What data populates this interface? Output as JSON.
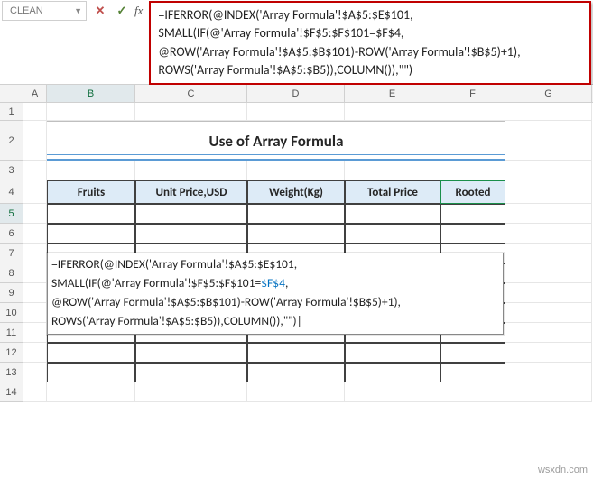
{
  "namebox": {
    "value": "CLEAN"
  },
  "fx": {
    "cancel": "✕",
    "enter": "✓",
    "label": "fx"
  },
  "formula_bar": {
    "line1": "=IFERROR(@INDEX('Array Formula'!$A$5:$E$101,",
    "line2": "SMALL(IF(@'Array Formula'!$F$5:$F$101=$F$4,",
    "line3": "@ROW('Array Formula'!$A$5:$B$101)-ROW('Array Formula'!$B$5)+1),",
    "line4": "ROWS('Array Formula'!$A$5:$B5)),COLUMN()),\"\")"
  },
  "columns": {
    "A": "A",
    "B": "B",
    "C": "C",
    "D": "D",
    "E": "E",
    "F": "F",
    "G": "G"
  },
  "rows": {
    "1": "1",
    "2": "2",
    "3": "3",
    "4": "4",
    "5": "5",
    "6": "6",
    "7": "7",
    "8": "8",
    "9": "9",
    "10": "10",
    "11": "11",
    "12": "12",
    "13": "13",
    "14": "14"
  },
  "title": "Use of Array Formula",
  "headers": {
    "b": "Fruits",
    "c": "Unit Price,USD",
    "d": "Weight(Kg)",
    "e": "Total Price",
    "f": "Rooted"
  },
  "cell_edit": {
    "line1": "=IFERROR(@INDEX('Array Formula'!$A$5:$E$101,",
    "line2_a": "SMALL(IF(@'Array Formula'!$F$5:$F$101=",
    "line2_ref": "$F$4",
    "line2_b": ",",
    "line3": "@ROW('Array Formula'!$A$5:$B$101)-ROW('Array Formula'!$B$5)+1),",
    "line4": "ROWS('Array Formula'!$A$5:$B5)),COLUMN()),\"\")",
    "cursor": "|"
  },
  "watermark": "wsxdn.com"
}
